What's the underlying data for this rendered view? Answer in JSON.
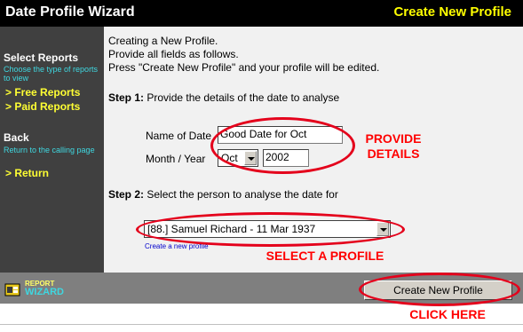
{
  "header": {
    "title": "Date Profile Wizard",
    "mode": "Create New Profile"
  },
  "sidebar": {
    "sections": [
      {
        "heading": "Select Reports",
        "description": "Choose the type of reports to view",
        "links": [
          "> Free Reports",
          "> Paid Reports"
        ]
      },
      {
        "heading": "Back",
        "description": "Return to the calling page",
        "links": [
          "> Return"
        ]
      }
    ]
  },
  "content": {
    "intro": [
      "Creating a New Profile.",
      "Provide all fields as follows.",
      "Press \"Create New Profile\" and your profile will be edited."
    ],
    "step1": {
      "label": "Step 1:",
      "text": " Provide the details of the date to analyse"
    },
    "name_label": "Name of Date",
    "name_value": "Good Date for Oct",
    "month_label": "Month / Year",
    "month_value": "Oct",
    "year_value": "2002",
    "step2": {
      "label": "Step 2:",
      "text": " Select the person to analyse the date for"
    },
    "person_value": "[88.] Samuel Richard - 11 Mar 1937",
    "create_link": "Create a new profile"
  },
  "footer": {
    "logo_text": [
      "REPORT",
      "WIZARD"
    ],
    "button_label": "Create New Profile"
  },
  "annotations": {
    "provide": [
      "PROVIDE",
      "DETAILS"
    ],
    "select": "SELECT A PROFILE",
    "click": "CLICK HERE"
  },
  "colors": {
    "accent_yellow": "#ffff00",
    "link_cyan": "#3fd7e0",
    "annotation_red": "#ff0000"
  }
}
